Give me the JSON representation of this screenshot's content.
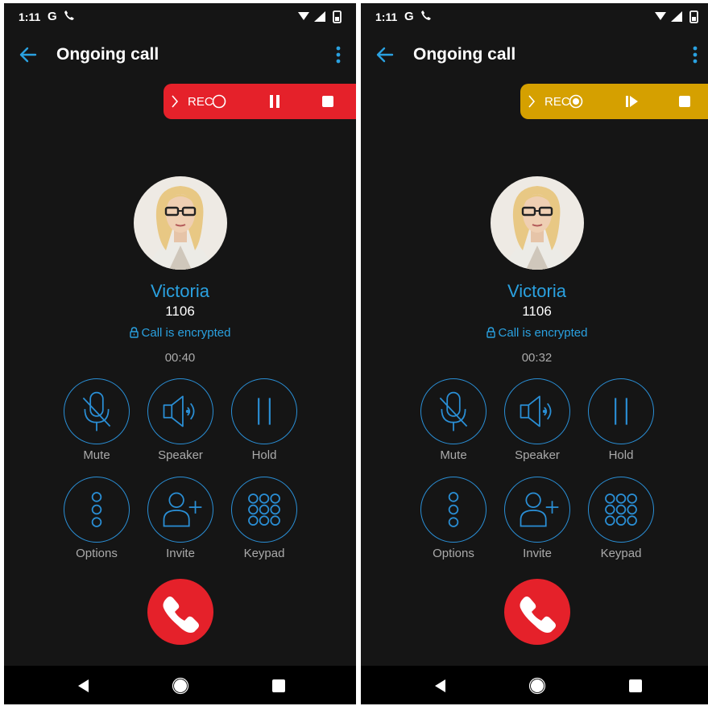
{
  "screens": [
    {
      "status": {
        "time": "1:11",
        "google": "G"
      },
      "app_bar": {
        "title": "Ongoing call"
      },
      "recording": {
        "label": "REC",
        "state": "recording",
        "color": "#e5212a"
      },
      "contact": {
        "name": "Victoria",
        "extension": "1106",
        "encryption": "Call is encrypted",
        "duration": "00:40"
      },
      "controls": {
        "mute": "Mute",
        "speaker": "Speaker",
        "hold": "Hold",
        "options": "Options",
        "invite": "Invite",
        "keypad": "Keypad"
      }
    },
    {
      "status": {
        "time": "1:11",
        "google": "G"
      },
      "app_bar": {
        "title": "Ongoing call"
      },
      "recording": {
        "label": "REC",
        "state": "paused",
        "color": "#d5a000"
      },
      "contact": {
        "name": "Victoria",
        "extension": "1106",
        "encryption": "Call is encrypted",
        "duration": "00:32"
      },
      "controls": {
        "mute": "Mute",
        "speaker": "Speaker",
        "hold": "Hold",
        "options": "Options",
        "invite": "Invite",
        "keypad": "Keypad"
      }
    }
  ],
  "icons": [
    "back-arrow-icon",
    "more-vert-icon",
    "chevron-right-icon",
    "record-ring-icon",
    "pause-icon",
    "resume-icon",
    "stop-icon",
    "lock-icon",
    "mic-off-icon",
    "speaker-icon",
    "hold-icon",
    "options-icon",
    "add-person-icon",
    "keypad-icon",
    "end-call-icon",
    "nav-back-icon",
    "nav-home-icon",
    "nav-recents-icon"
  ],
  "colors": {
    "accent": "#2aa1e0",
    "background": "#151515",
    "record_red": "#e5212a",
    "record_paused": "#d5a000"
  }
}
